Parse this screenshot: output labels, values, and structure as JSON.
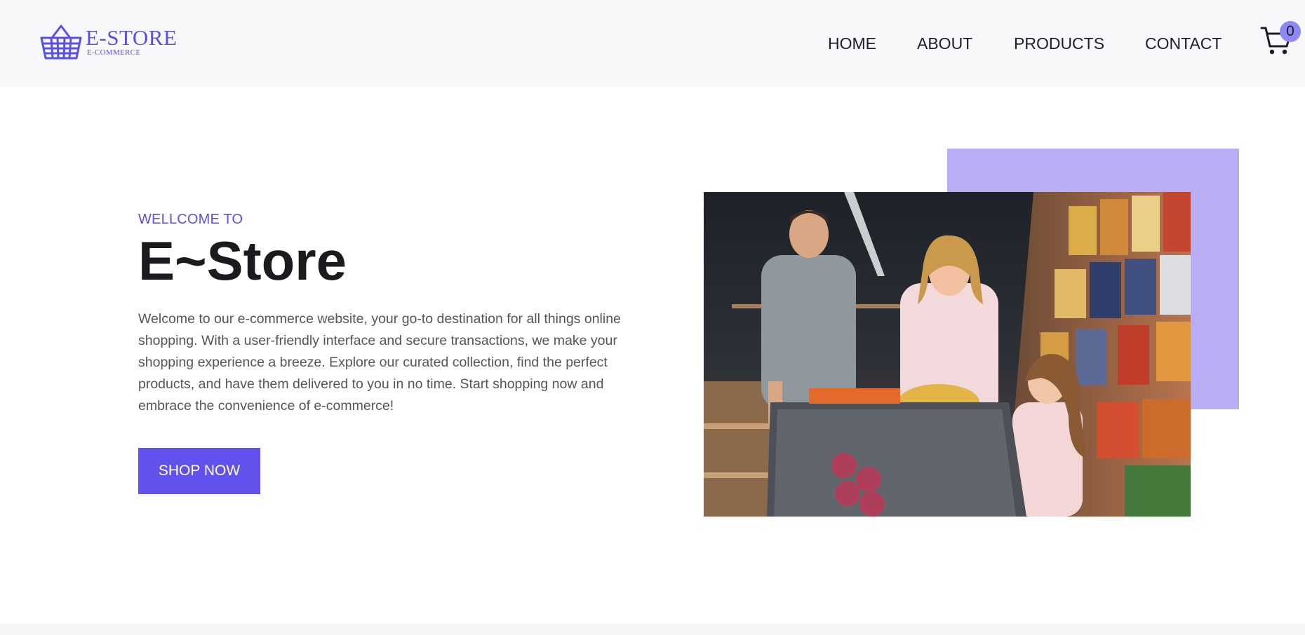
{
  "header": {
    "logo": {
      "title": "E-STORE",
      "subtitle": "E-COMMERCE",
      "icon": "basket-icon"
    },
    "nav": [
      {
        "label": "HOME"
      },
      {
        "label": "ABOUT"
      },
      {
        "label": "PRODUCTS"
      },
      {
        "label": "CONTACT"
      }
    ],
    "cart": {
      "icon": "cart-icon",
      "count": "0"
    }
  },
  "hero": {
    "eyebrow": "WELLCOME TO",
    "title": "E~Store",
    "description": "Welcome to our e-commerce website, your go-to destination for all things online shopping. With a user-friendly interface and secure transactions, we make your shopping experience a breeze. Explore our curated collection, find the perfect products, and have them delivered to you in no time. Start shopping now and embrace the convenience of e-commerce!",
    "cta_label": "SHOP NOW",
    "image_subject": "family-shopping-in-supermarket"
  },
  "colors": {
    "brand": "#5b50e6",
    "button": "#6152ee",
    "accent_block": "#b7aef5",
    "badge": "#8e88f6",
    "header_bg": "#f7f8fa"
  }
}
